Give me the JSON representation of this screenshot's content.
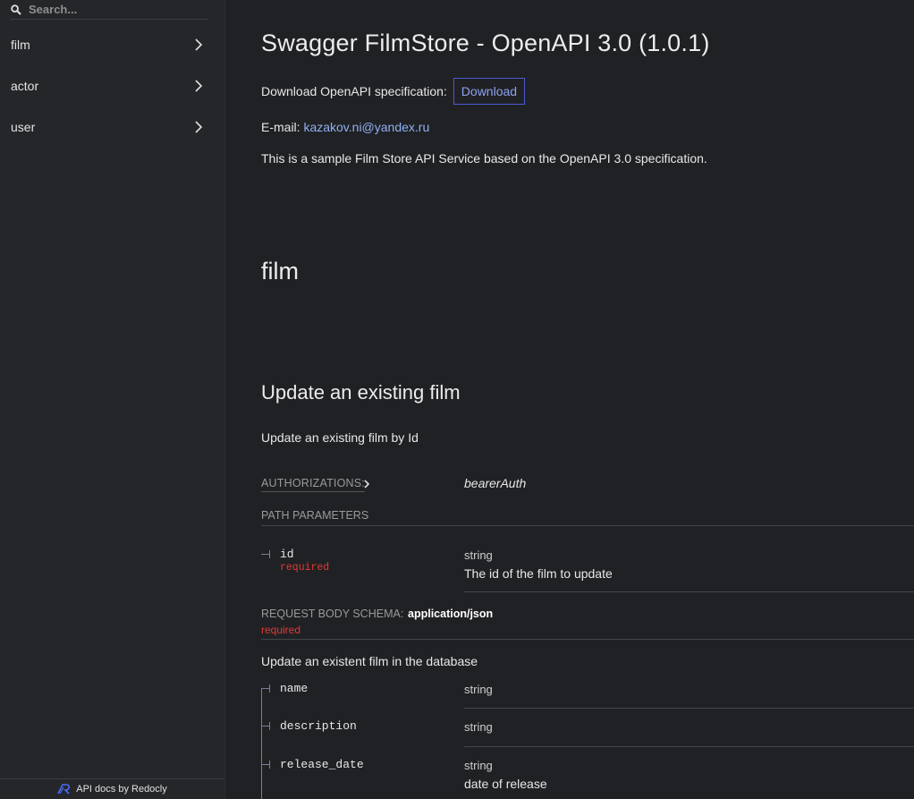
{
  "search": {
    "placeholder": "Search..."
  },
  "sidebar": {
    "items": [
      {
        "label": "film"
      },
      {
        "label": "actor"
      },
      {
        "label": "user"
      }
    ],
    "footer": "API docs by Redocly"
  },
  "header": {
    "title": "Swagger FilmStore - OpenAPI 3.0 (1.0.1)",
    "download_label": "Download OpenAPI specification:",
    "download_button": "Download",
    "email_label": "E-mail:",
    "email": "kazakov.ni@yandex.ru",
    "description": "This is a sample Film Store API Service based on the OpenAPI 3.0 specification."
  },
  "section": {
    "title": "film"
  },
  "operation": {
    "title": "Update an existing film",
    "description": "Update an existing film by Id",
    "authorizations_label": "AUTHORIZATIONS:",
    "auth_scheme": "bearerAuth",
    "path_params_label": "PATH PARAMETERS",
    "path_params": [
      {
        "name": "id",
        "required": "required",
        "type": "string",
        "description": "The id of the film to update"
      }
    ],
    "request_body_label": "REQUEST BODY SCHEMA:",
    "request_body_type": "application/json",
    "request_body_required": "required",
    "request_body_description": "Update an existent film in the database",
    "fields": [
      {
        "name": "name",
        "type": "string"
      },
      {
        "name": "description",
        "type": "string"
      },
      {
        "name": "release_date",
        "type": "string",
        "description": "date of release"
      }
    ]
  },
  "colors": {
    "background": "#202124",
    "sidebar": "#252629",
    "link": "#8fb0f2",
    "required": "#e53935",
    "button_border": "#4b5bd1"
  }
}
